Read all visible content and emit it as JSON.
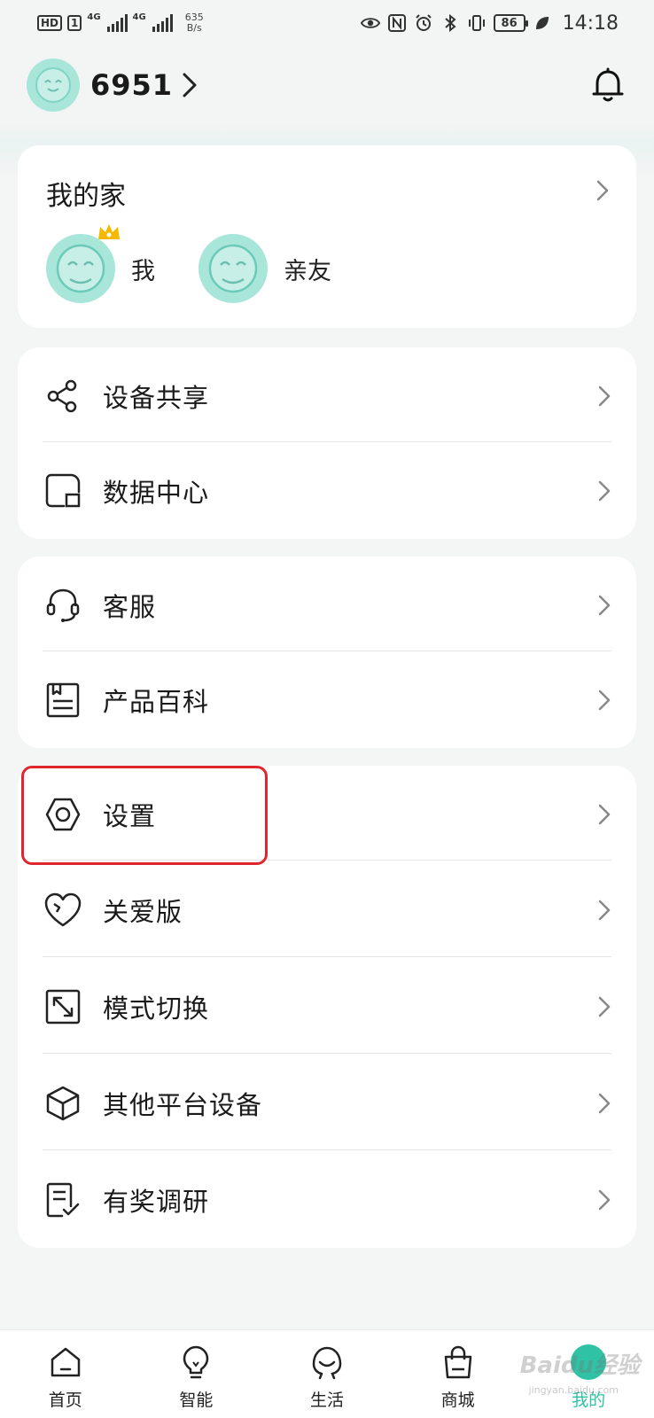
{
  "status_bar": {
    "hd": "HD",
    "sim1": "1",
    "network_a": "4G",
    "network_b": "4G",
    "speed_value": "635",
    "speed_unit": "B/s",
    "battery": "86",
    "time": "14:18"
  },
  "header": {
    "user_name": "6951"
  },
  "family": {
    "title": "我的家",
    "members": [
      {
        "label": "我"
      },
      {
        "label": "亲友"
      }
    ]
  },
  "group1": [
    {
      "label": "设备共享",
      "icon": "share-icon"
    },
    {
      "label": "数据中心",
      "icon": "data-center-icon"
    }
  ],
  "group2": [
    {
      "label": "客服",
      "icon": "headset-icon"
    },
    {
      "label": "产品百科",
      "icon": "book-icon"
    }
  ],
  "group3": [
    {
      "label": "设置",
      "icon": "settings-hexagon-icon"
    },
    {
      "label": "关爱版",
      "icon": "heart-icon"
    },
    {
      "label": "模式切换",
      "icon": "mode-switch-icon"
    },
    {
      "label": "其他平台设备",
      "icon": "cube-icon"
    },
    {
      "label": "有奖调研",
      "icon": "survey-icon"
    }
  ],
  "bottom_nav": [
    {
      "label": "首页",
      "icon": "home-icon"
    },
    {
      "label": "智能",
      "icon": "bulb-icon"
    },
    {
      "label": "生活",
      "icon": "life-icon"
    },
    {
      "label": "商城",
      "icon": "shopping-bag-icon"
    },
    {
      "label": "我的",
      "icon": "profile-icon",
      "active": true
    }
  ],
  "colors": {
    "accent": "#2fc2a5",
    "avatar_bg": "#a8e6da",
    "highlight": "#e0262e"
  },
  "watermark": {
    "main": "Baidu经验",
    "sub": "jingyan.baidu.com"
  }
}
